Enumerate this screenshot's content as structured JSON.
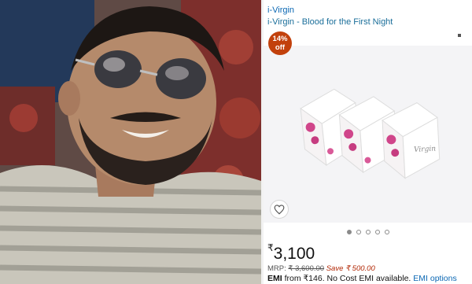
{
  "listing": {
    "brand": "i-Virgin",
    "title": "i-Virgin - Blood for the First Night",
    "discount_value": "14%",
    "discount_suffix": "off",
    "carousel": {
      "count": 5,
      "active_index": 0
    },
    "price_symbol": "₹",
    "price_amount": "3,100",
    "mrp_label": "MRP:",
    "mrp_value": "₹ 3,600.00",
    "save_text": "Save ₹ 500.00",
    "emi_label": "EMI",
    "emi_text": " from ₹146. No Cost EMI available. ",
    "emi_link": "EMI options",
    "product_box_text": "Virgin"
  },
  "icons": {
    "wishlist": "heart-outline-icon",
    "menu": "square-dot-icon"
  },
  "colors": {
    "brand_link": "#0a67b3",
    "discount_badge": "#c2410c",
    "save_text": "#b12704",
    "box_floral": "#d0458a"
  }
}
